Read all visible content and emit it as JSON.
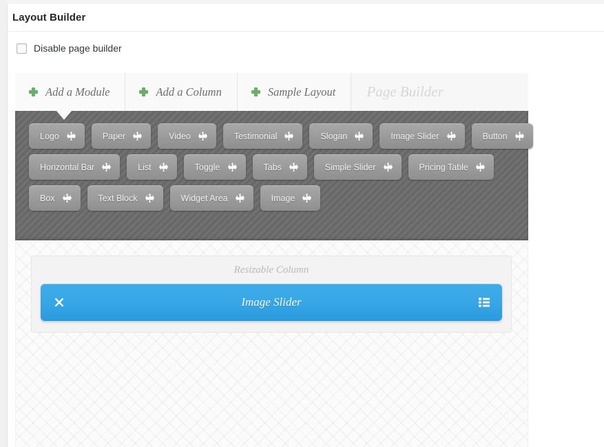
{
  "metabox": {
    "title": "Layout Builder"
  },
  "disable_option": {
    "label": "Disable page builder",
    "checked": false,
    "icon": "checkbox-icon"
  },
  "tabs": [
    {
      "label": "Add a Module",
      "icon": "plus-icon",
      "active": true
    },
    {
      "label": "Add a Column",
      "icon": "plus-icon",
      "active": false
    },
    {
      "label": "Sample Layout",
      "icon": "plus-icon",
      "active": false
    }
  ],
  "tabbar": {
    "title": "Page Builder"
  },
  "palette": {
    "rows": [
      [
        {
          "label": "Logo",
          "icon": "move-icon"
        },
        {
          "label": "Paper",
          "icon": "move-icon"
        },
        {
          "label": "Video",
          "icon": "move-icon"
        },
        {
          "label": "Testimonial",
          "icon": "move-icon"
        },
        {
          "label": "Slogan",
          "icon": "move-icon"
        },
        {
          "label": "Image Slider",
          "icon": "move-icon"
        },
        {
          "label": "Button",
          "icon": "move-icon"
        }
      ],
      [
        {
          "label": "Horizontal Bar",
          "icon": "move-icon"
        },
        {
          "label": "List",
          "icon": "move-icon"
        },
        {
          "label": "Toggle",
          "icon": "move-icon"
        },
        {
          "label": "Tabs",
          "icon": "move-icon"
        },
        {
          "label": "Simple Slider",
          "icon": "move-icon"
        },
        {
          "label": "Pricing Table",
          "icon": "move-icon"
        }
      ],
      [
        {
          "label": "Box",
          "icon": "move-icon"
        },
        {
          "label": "Text Block",
          "icon": "move-icon"
        },
        {
          "label": "Widget Area",
          "icon": "move-icon"
        },
        {
          "label": "Image",
          "icon": "move-icon"
        }
      ]
    ]
  },
  "canvas": {
    "column": {
      "title": "Resizable Column",
      "module": {
        "title": "Image Slider",
        "close_icon": "close-icon",
        "options_icon": "list-icon"
      }
    }
  },
  "colors": {
    "accent_green": "#65b168",
    "module_blue": "#36a6e6",
    "palette_gray": "#6d6d6d",
    "tab_text": "#6d6d6d",
    "title_text": "#23282d"
  }
}
